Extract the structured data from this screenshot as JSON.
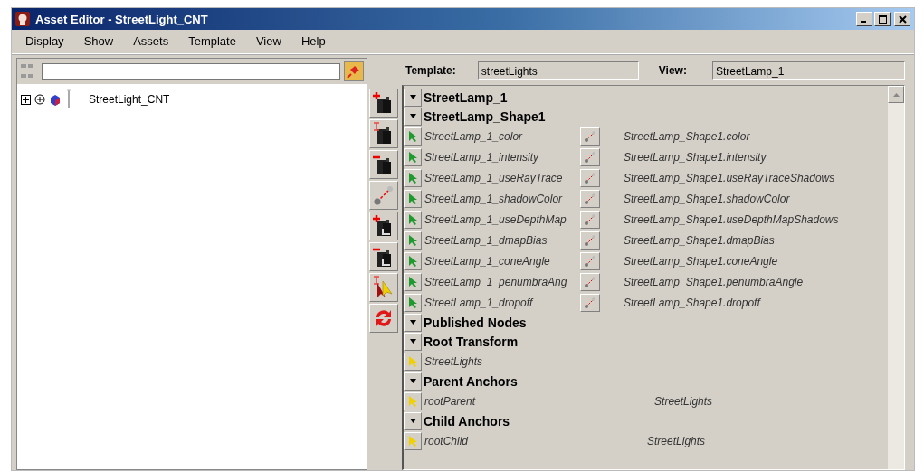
{
  "window": {
    "title": "Asset Editor - StreetLight_CNT"
  },
  "menu": [
    "Display",
    "Show",
    "Assets",
    "Template",
    "View",
    "Help"
  ],
  "left_panel": {
    "tree": [
      {
        "label": "StreetLight_CNT",
        "expanded": false
      }
    ]
  },
  "template": {
    "label": "Template:",
    "value": "streetLights"
  },
  "view": {
    "label": "View:",
    "value": "StreetLamp_1"
  },
  "rows": [
    {
      "kind": "section",
      "label": "StreetLamp_1",
      "expanded": true
    },
    {
      "kind": "section",
      "label": "StreetLamp_Shape1",
      "expanded": true
    },
    {
      "kind": "attribute",
      "name": "StreetLamp_1_color",
      "target": "StreetLamp_Shape1.color"
    },
    {
      "kind": "attribute",
      "name": "StreetLamp_1_intensity",
      "target": "StreetLamp_Shape1.intensity"
    },
    {
      "kind": "attribute",
      "name": "StreetLamp_1_useRayTrace",
      "target": "StreetLamp_Shape1.useRayTraceShadows"
    },
    {
      "kind": "attribute",
      "name": "StreetLamp_1_shadowColor",
      "target": "StreetLamp_Shape1.shadowColor"
    },
    {
      "kind": "attribute",
      "name": "StreetLamp_1_useDepthMap",
      "target": "StreetLamp_Shape1.useDepthMapShadows"
    },
    {
      "kind": "attribute",
      "name": "StreetLamp_1_dmapBias",
      "target": "StreetLamp_Shape1.dmapBias"
    },
    {
      "kind": "attribute",
      "name": "StreetLamp_1_coneAngle",
      "target": "StreetLamp_Shape1.coneAngle"
    },
    {
      "kind": "attribute",
      "name": "StreetLamp_1_penumbraAng",
      "target": "StreetLamp_Shape1.penumbraAngle"
    },
    {
      "kind": "attribute",
      "name": "StreetLamp_1_dropoff",
      "target": "StreetLamp_Shape1.dropoff"
    },
    {
      "kind": "section",
      "label": "Published Nodes",
      "expanded": true
    },
    {
      "kind": "section",
      "label": "Root Transform",
      "expanded": true
    },
    {
      "kind": "node",
      "name": "StreetLights"
    },
    {
      "kind": "section",
      "label": "Parent Anchors",
      "expanded": true
    },
    {
      "kind": "node",
      "name": "rootParent",
      "target": "StreetLights"
    },
    {
      "kind": "section",
      "label": "Child Anchors",
      "expanded": true
    },
    {
      "kind": "node",
      "name": "rootChild",
      "target": "StreetLights"
    }
  ]
}
